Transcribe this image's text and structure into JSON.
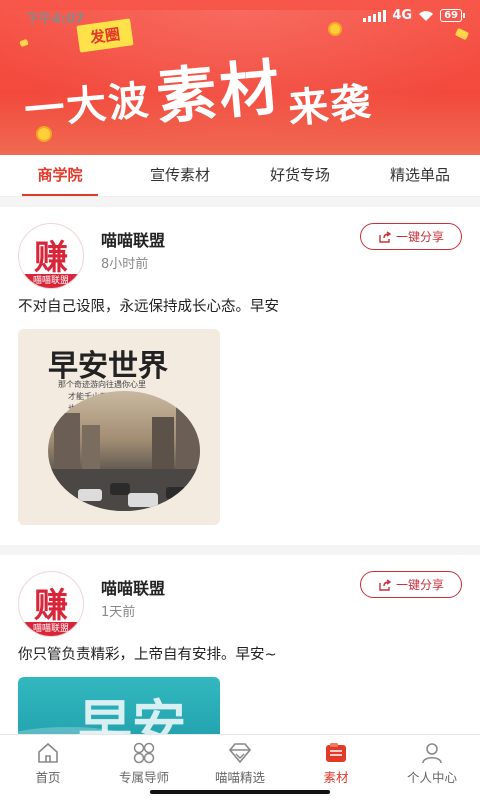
{
  "status_bar": {
    "time": "下午4:07",
    "network": "4G",
    "battery": "69"
  },
  "banner": {
    "tag": "发圈",
    "headline_small_1": "一大波",
    "headline_big": "素材",
    "headline_small_2": "来袭"
  },
  "tabs": [
    {
      "label": "商学院",
      "active": true
    },
    {
      "label": "宣传素材",
      "active": false
    },
    {
      "label": "好货专场",
      "active": false
    },
    {
      "label": "精选单品",
      "active": false
    }
  ],
  "posts": [
    {
      "avatar_glyph": "赚",
      "avatar_sub": "喵喵联盟",
      "name": "喵喵联盟",
      "time": "8小时前",
      "share_label": "一键分享",
      "text": "不对自己设限，永远保持成长心态。早安",
      "image": {
        "title": "早安世界",
        "line1": "那个奇迹游向往遇你心里",
        "line2": "才能千山万水",
        "line3": "也不畏惧"
      }
    },
    {
      "avatar_glyph": "赚",
      "avatar_sub": "喵喵联盟",
      "name": "喵喵联盟",
      "time": "1天前",
      "share_label": "一键分享",
      "text": "你只管负责精彩，上帝自有安排。早安~",
      "image": {
        "title": "早安"
      }
    }
  ],
  "bottom_nav": [
    {
      "label": "首页",
      "icon": "home-icon",
      "active": false
    },
    {
      "label": "专属导师",
      "icon": "grid-icon",
      "active": false
    },
    {
      "label": "喵喵精选",
      "icon": "diamond-icon",
      "active": false
    },
    {
      "label": "素材",
      "icon": "material-icon",
      "active": true
    },
    {
      "label": "个人中心",
      "icon": "person-icon",
      "active": false
    }
  ],
  "colors": {
    "accent": "#e2392b",
    "banner": "#f2493c",
    "share": "#c9303c"
  }
}
